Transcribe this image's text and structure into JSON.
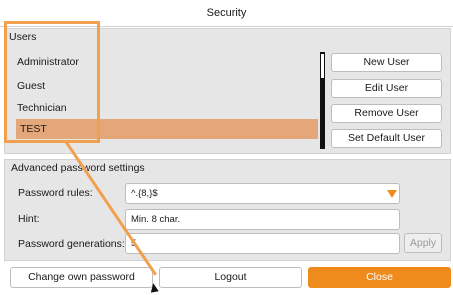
{
  "window": {
    "title": "Security"
  },
  "users": {
    "section_label": "Users",
    "list": [
      {
        "label": "Administrator",
        "selected": false
      },
      {
        "label": "Guest",
        "selected": false
      },
      {
        "label": "Technician",
        "selected": false
      },
      {
        "label": "TEST",
        "selected": true
      }
    ],
    "buttons": {
      "new_user": "New User",
      "edit_user": "Edit User",
      "remove_user": "Remove User",
      "set_default_user": "Set Default User"
    }
  },
  "advanced": {
    "section_label": "Advanced password settings",
    "password_rules": {
      "label": "Password rules:",
      "value": "^.{8,}$"
    },
    "hint": {
      "label": "Hint:",
      "value": "Min. 8 char."
    },
    "password_generations": {
      "label": "Password generations:",
      "value": "5",
      "apply_label": "Apply"
    }
  },
  "footer": {
    "change_own_password": "Change own password",
    "logout": "Logout",
    "close": "Close"
  },
  "colors": {
    "accent": "#ee8b1c",
    "selection": "#e3a779",
    "panel": "#e6e6e6",
    "annotation": "#f2a04e"
  }
}
